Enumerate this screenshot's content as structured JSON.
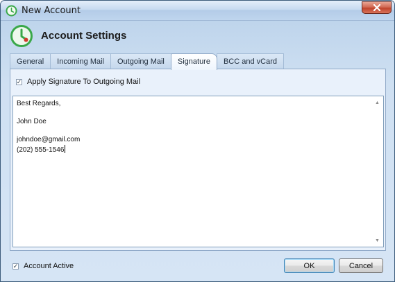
{
  "window": {
    "title": "New Account",
    "close_icon": "close-icon"
  },
  "header": {
    "title": "Account Settings",
    "icon": "account-settings-icon"
  },
  "tabs": [
    {
      "label": "General",
      "active": false
    },
    {
      "label": "Incoming Mail",
      "active": false
    },
    {
      "label": "Outgoing Mail",
      "active": false
    },
    {
      "label": "Signature",
      "active": true
    },
    {
      "label": "BCC and vCard",
      "active": false
    }
  ],
  "signature_tab": {
    "apply_checkbox": {
      "label": "Apply Signature To Outgoing Mail",
      "checked": true
    },
    "signature_text": "Best Regards,\n\nJohn Doe\n\njohndoe@gmail.com\n(202) 555-1546"
  },
  "footer": {
    "account_active": {
      "label": "Account Active",
      "checked": true
    },
    "ok_label": "OK",
    "cancel_label": "Cancel"
  },
  "colors": {
    "accent_green": "#3aa84a",
    "close_red": "#c0442c"
  }
}
